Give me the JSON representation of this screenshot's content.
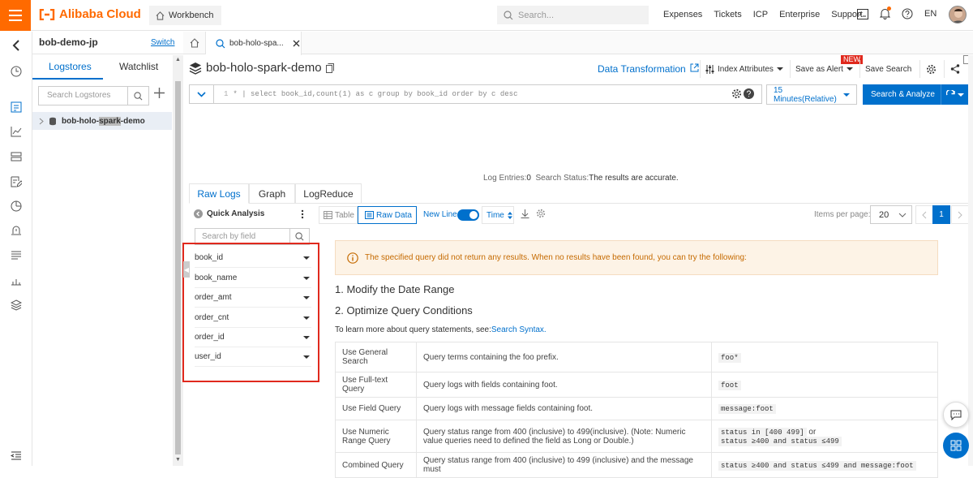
{
  "topbar": {
    "logo_text": "Alibaba Cloud",
    "workbench_label": "Workbench",
    "search_placeholder": "Search...",
    "links": [
      "Expenses",
      "Tickets",
      "ICP",
      "Enterprise",
      "Support"
    ],
    "language": "EN",
    "brand_color": "#ff6a00"
  },
  "project": {
    "name": "bob-demo-jp",
    "switch_label": "Switch"
  },
  "side": {
    "tabs": [
      "Logstores",
      "Watchlist"
    ],
    "search_placeholder": "Search Logstores",
    "tree_item_prefix": "bob-holo-",
    "tree_item_highlight": "spark",
    "tree_item_suffix": "-demo"
  },
  "page_tab": {
    "label": "bob-holo-spa..."
  },
  "header": {
    "logstore_name": "bob-holo-spark-demo",
    "data_transformation": "Data Transformation",
    "index_attributes": "Index Attributes",
    "save_as_alert": "Save as Alert",
    "new_badge": "NEW",
    "save_search": "Save Search"
  },
  "query": {
    "line_number": "1",
    "text": "* | select book_id,count(1) as c group by book_id order by c desc",
    "time_range": "15 Minutes(Relative)",
    "search_button": "Search & Analyze"
  },
  "status": {
    "entries_label": "Log Entries:",
    "entries_value": "0",
    "status_label": "Search Status:",
    "status_value": "The results are accurate."
  },
  "result_tabs": [
    "Raw Logs",
    "Graph",
    "LogReduce"
  ],
  "quick_analysis": {
    "title": "Quick Analysis",
    "search_placeholder": "Search by field",
    "fields": [
      "book_id",
      "book_name",
      "order_amt",
      "order_cnt",
      "order_id",
      "user_id"
    ]
  },
  "toolbar": {
    "table_label": "Table",
    "raw_label": "Raw Data",
    "new_line_label": "New Line",
    "time_label": "Time",
    "items_per_page_label": "Items per page:",
    "items_per_page_value": "20",
    "current_page": "1"
  },
  "content": {
    "warning": "The specified query did not return any results. When no results have been found, you can try the following:",
    "step1": "1. Modify the Date Range",
    "step2": "2. Optimize Query Conditions",
    "learn_more_prefix": "To learn more about query statements, see:",
    "learn_more_link": "Search Syntax.",
    "rows": [
      {
        "name": "Use General Search",
        "desc": "Query terms containing the foo prefix.",
        "example": "foo*",
        "example2": ""
      },
      {
        "name": "Use Full-text Query",
        "desc": "Query logs with fields containing foot.",
        "example": "foot",
        "example2": ""
      },
      {
        "name": "Use Field Query",
        "desc": "Query logs with message fields containing foot.",
        "example": "message:foot",
        "example2": ""
      },
      {
        "name": "Use Numeric Range Query",
        "desc": "Query status range from 400 (inclusive) to 499(inclusive). (Note: Numeric value queries need to defined the field as Long or Double.)",
        "example": "status in [400 499]",
        "example_or": "or",
        "example2": "status ≥400 and status ≤499"
      },
      {
        "name": "Combined Query",
        "desc": "Query status range from 400 (inclusive) to 499 (inclusive) and the message must",
        "example": "status ≥400 and status ≤499 and message:foot",
        "example2": ""
      }
    ]
  }
}
